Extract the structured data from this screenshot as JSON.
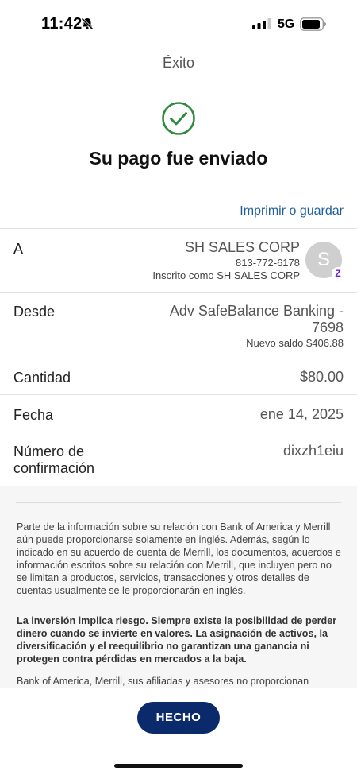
{
  "status_bar": {
    "time": "11:42",
    "network": "5G",
    "icons": [
      "bell-slash-icon",
      "signal-icon",
      "battery-icon"
    ]
  },
  "header": {
    "title": "Éxito",
    "headline": "Su pago fue enviado",
    "success_icon": "check-circle-icon",
    "print_link": "Imprimir o guardar"
  },
  "details": {
    "to": {
      "label": "A",
      "name": "SH SALES CORP",
      "phone": "813-772-6178",
      "enrolled": "Inscrito como SH SALES CORP",
      "avatar_letter": "S",
      "badge_icon": "zelle-icon"
    },
    "from": {
      "label": "Desde",
      "account_line1": "Adv SafeBalance Banking -",
      "account_line2": "7698",
      "new_balance": "Nuevo saldo $406.88"
    },
    "amount": {
      "label": "Cantidad",
      "value": "$80.00"
    },
    "date": {
      "label": "Fecha",
      "value": "ene 14, 2025"
    },
    "confirmation": {
      "label_line1": "Número de",
      "label_line2": "confirmación",
      "value": "dixzh1eiu"
    }
  },
  "disclosure": {
    "paragraph1": "Parte de la información sobre su relación con Bank of America y Merrill aún puede proporcionarse solamente en inglés. Además, según lo indicado en su acuerdo de cuenta de Merrill, los documentos, acuerdos e información escritos sobre su relación con Merrill, que incluyen pero no se limitan a productos, servicios, transacciones y otros detalles de cuentas usualmente se le proporcionarán en inglés.",
    "paragraph2": "La inversión implica riesgo. Siempre existe la posibilidad de perder dinero cuando se invierte en valores. La asignación de activos, la diversificación y el reequilibrio no garantizan una ganancia ni protegen contra pérdidas en mercados a la baja.",
    "paragraph3": "Bank of America, Merrill, sus afiliadas y asesores no proporcionan"
  },
  "footer": {
    "done_label": "HECHO"
  },
  "colors": {
    "accent_green": "#2e8b3d",
    "link_blue": "#1f5f9e",
    "button_navy": "#0a2a6b",
    "zelle_purple": "#6d1ed4"
  }
}
